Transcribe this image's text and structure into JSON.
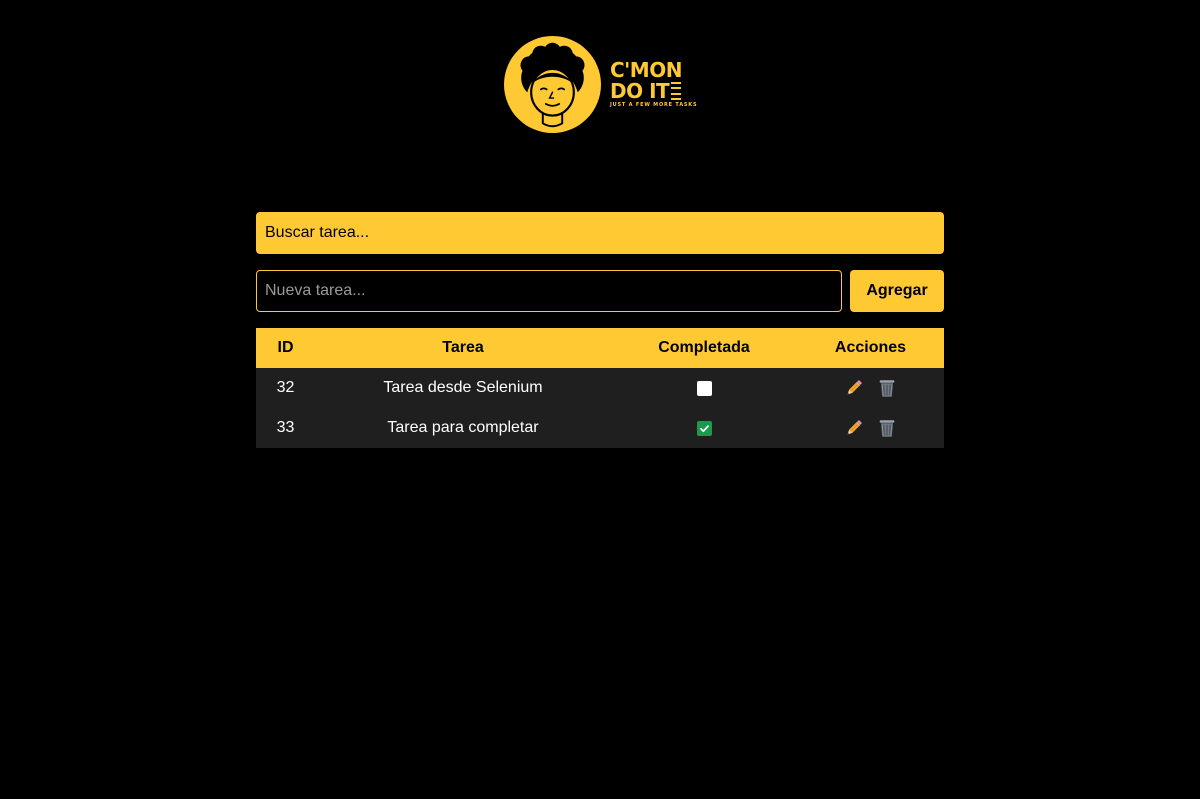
{
  "logo": {
    "line1": "C'MON",
    "line2": "DO IT",
    "tagline": "JUST A FEW MORE TASKS",
    "color": "#ffc933"
  },
  "search": {
    "placeholder": "Buscar tarea..."
  },
  "new_task": {
    "placeholder": "Nueva tarea...",
    "value": ""
  },
  "add_button": {
    "label": "Agregar"
  },
  "table": {
    "headers": {
      "id": "ID",
      "task": "Tarea",
      "done": "Completada",
      "actions": "Acciones"
    },
    "rows": [
      {
        "id": "32",
        "task": "Tarea desde Selenium",
        "completed": false
      },
      {
        "id": "33",
        "task": "Tarea para completar",
        "completed": true
      }
    ]
  },
  "icons": {
    "edit": "pencil-icon",
    "delete": "trash-can-icon"
  },
  "colors": {
    "accent": "#ffc933",
    "background": "#000000",
    "row_background": "#1f1f1f",
    "checked": "#1a9a4a"
  }
}
